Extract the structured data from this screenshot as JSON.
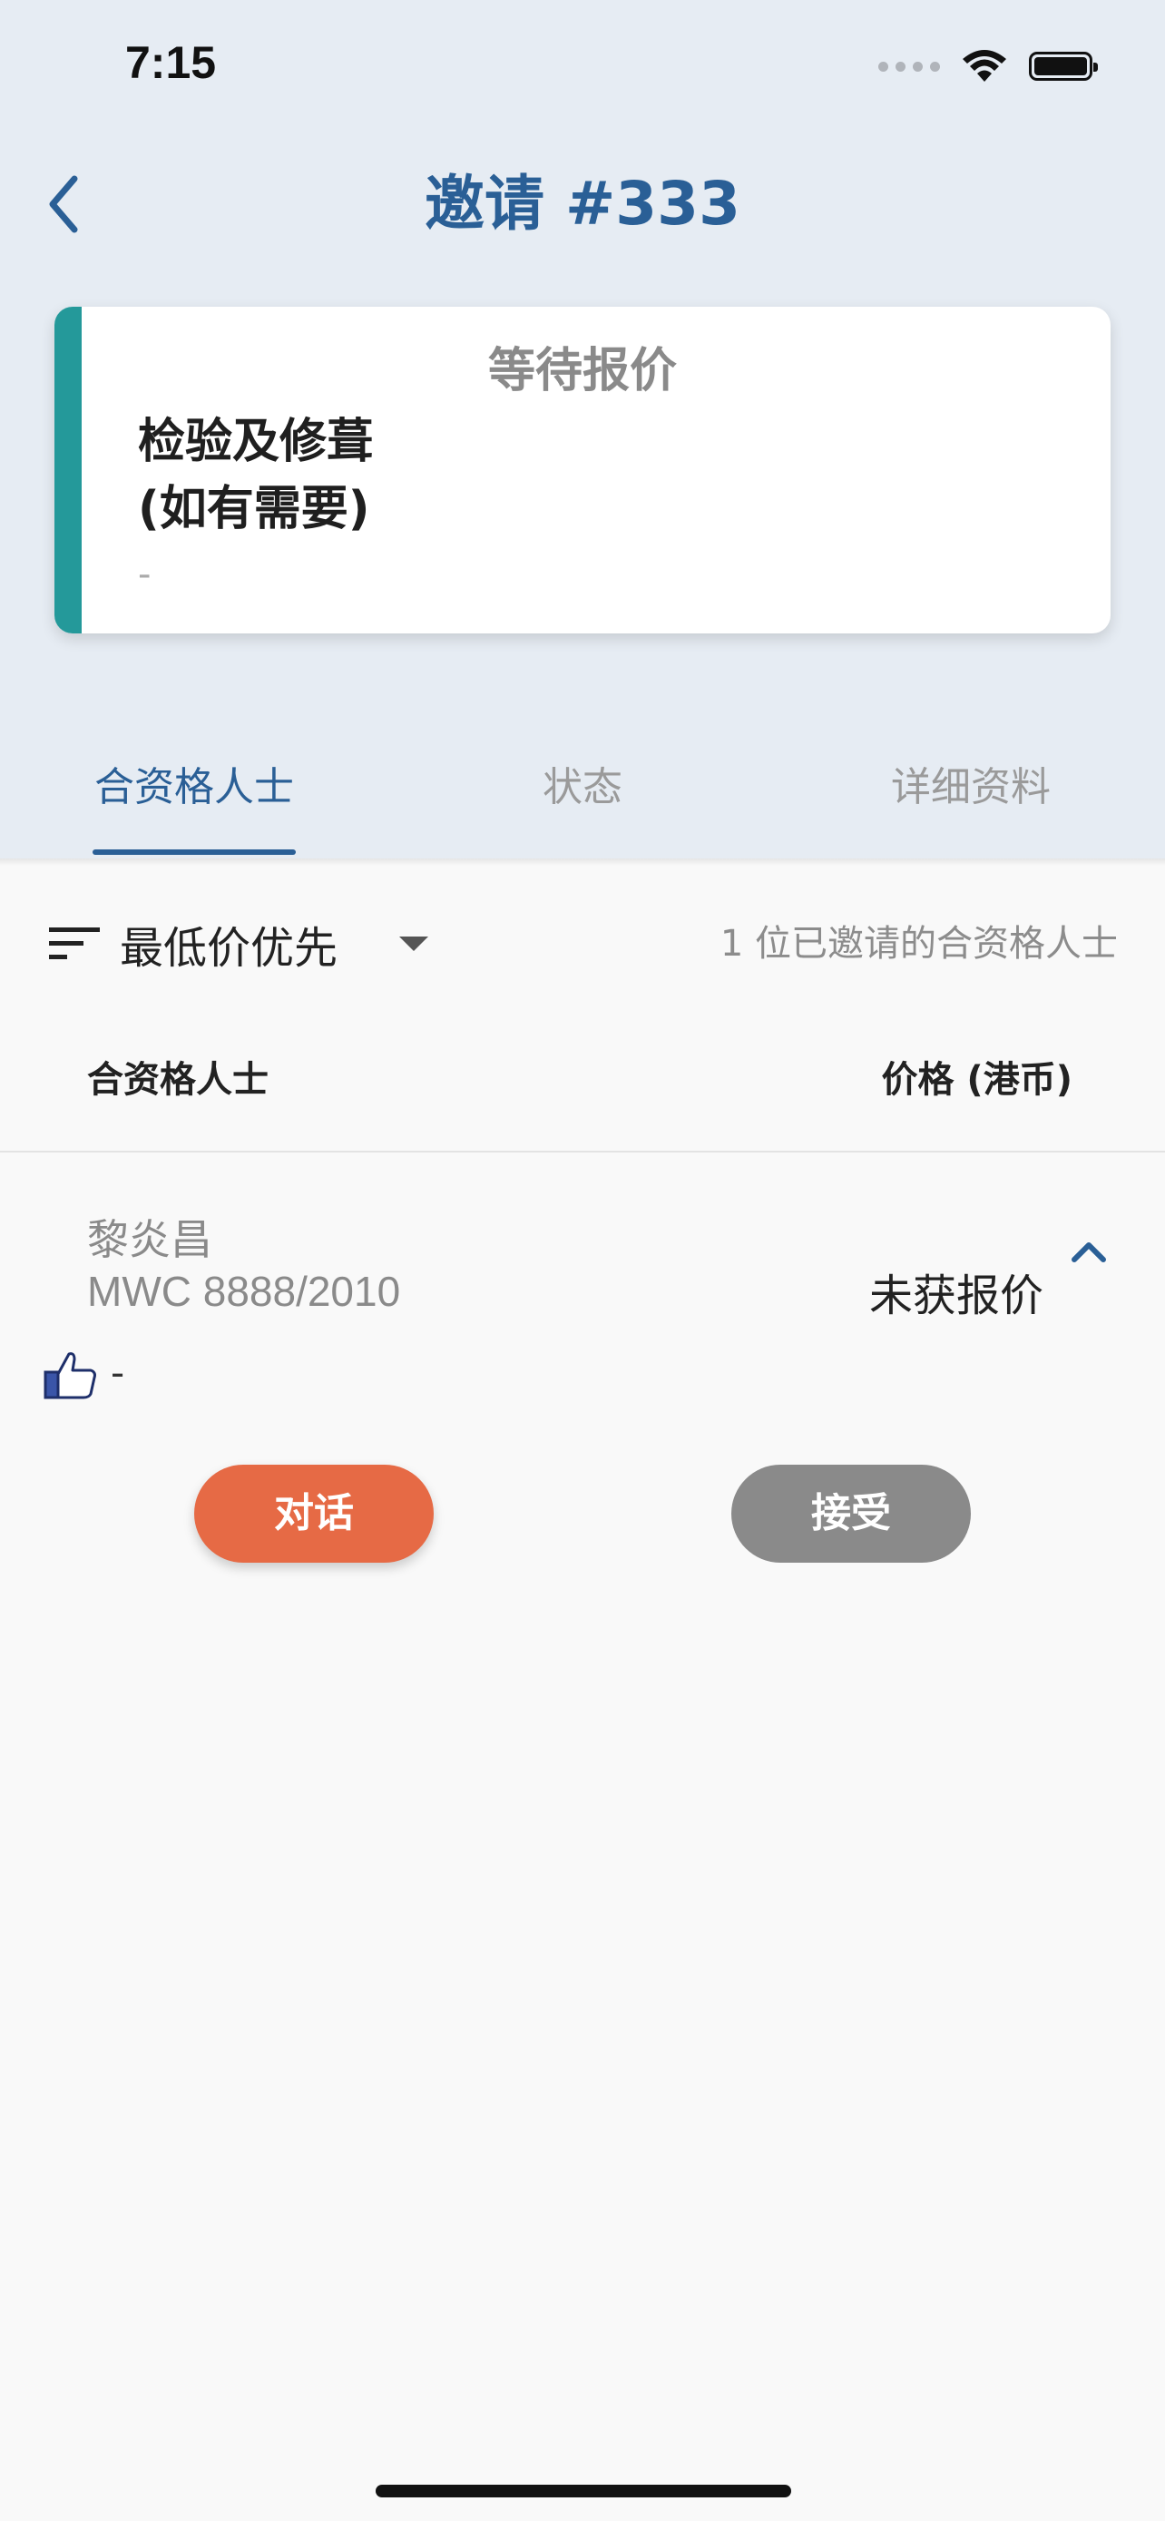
{
  "status_bar": {
    "time": "7:15"
  },
  "header": {
    "title": "邀请 #333"
  },
  "card": {
    "status": "等待报价",
    "title": "检验及修葺\n(如有需要)",
    "subtitle": "-",
    "accent_color": "#24999a"
  },
  "tabs": [
    {
      "label": "合资格人士",
      "active": true
    },
    {
      "label": "状态",
      "active": false
    },
    {
      "label": "详细资料",
      "active": false
    }
  ],
  "sort": {
    "label": "最低价优先"
  },
  "count_text": "1 位已邀请的合资格人士",
  "table": {
    "col_left": "合资格人士",
    "col_right": "价格 (港币)"
  },
  "rows": [
    {
      "name": "黎炎昌",
      "reg": "MWC 8888/2010",
      "price": "未获报价",
      "rating": "-",
      "chat_label": "对话",
      "accept_label": "接受"
    }
  ],
  "colors": {
    "primary": "#2a5f96",
    "chat_button": "#e66a45",
    "accept_button": "#8a8a8a"
  }
}
